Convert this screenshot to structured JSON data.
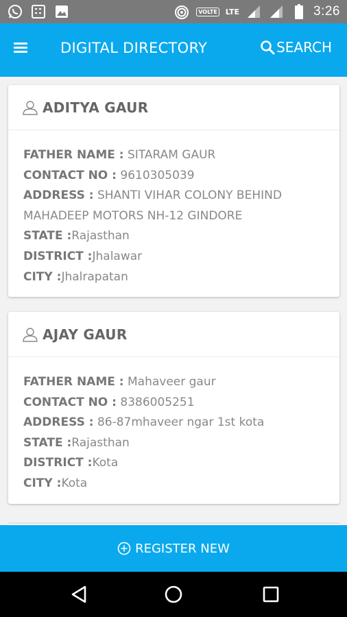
{
  "status_bar": {
    "time": "3:26",
    "volte": "VOLTE",
    "lte": "LTE",
    "icons": [
      "whatsapp-icon",
      "calculator-icon",
      "image-icon",
      "hotspot-icon",
      "signal-icon",
      "signal-icon",
      "battery-icon"
    ]
  },
  "app_bar": {
    "title": "DIGITAL DIRECTORY",
    "search_label": "SEARCH",
    "menu_icon": "menu-icon",
    "search_icon": "search-icon"
  },
  "labels": {
    "father": "FATHER NAME :",
    "contact": "CONTACT NO :",
    "address": "ADDRESS :",
    "state": "STATE :",
    "district": "DISTRICT :",
    "city": "CITY :"
  },
  "entries": [
    {
      "name": "ADITYA GAUR",
      "father_name": "SITARAM GAUR",
      "contact_no": "9610305039",
      "address_line1": "SHANTI VIHAR COLONY BEHIND",
      "address_line2": "MAHADEEP MOTORS NH-12 GINDORE",
      "state": "Rajasthan",
      "district": "Jhalawar",
      "city": "Jhalrapatan"
    },
    {
      "name": "AJAY GAUR",
      "father_name": "Mahaveer gaur",
      "contact_no": "8386005251",
      "address_line1": "86-87mhaveer ngar 1st kota",
      "state": "Rajasthan",
      "district": "Kota",
      "city": "Kota"
    }
  ],
  "register_button": {
    "label": "REGISTER NEW",
    "icon": "plus-circle-icon"
  },
  "colors": {
    "primary": "#0aa9ee",
    "status_bar": "#7a7a7a",
    "nav_bar": "#000000"
  }
}
